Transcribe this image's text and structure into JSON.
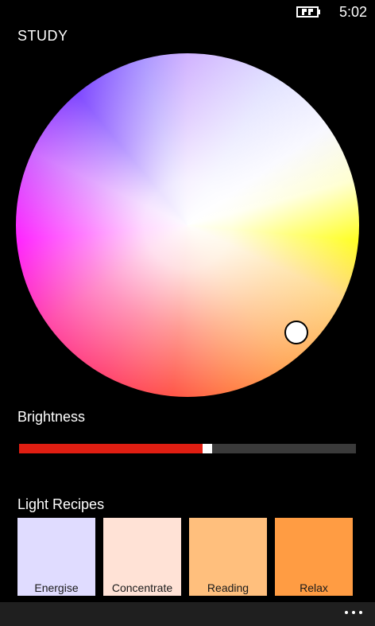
{
  "status_bar": {
    "time": "5:02",
    "battery_icon": "battery-charging-icon"
  },
  "page": {
    "title": "STUDY"
  },
  "color_wheel": {
    "handle_icon": "color-picker-handle-icon"
  },
  "brightness": {
    "label": "Brightness",
    "value_percent": 56,
    "fill_color": "#e01e12",
    "track_color": "#3a3a3a"
  },
  "recipes": {
    "label": "Light Recipes",
    "items": [
      {
        "label": "Energise",
        "color": "#e0dcff"
      },
      {
        "label": "Concentrate",
        "color": "#ffe2d6"
      },
      {
        "label": "Reading",
        "color": "#ffbf7d"
      },
      {
        "label": "Relax",
        "color": "#ff9c43"
      }
    ]
  },
  "app_bar": {
    "more_icon": "more-ellipsis-icon"
  }
}
